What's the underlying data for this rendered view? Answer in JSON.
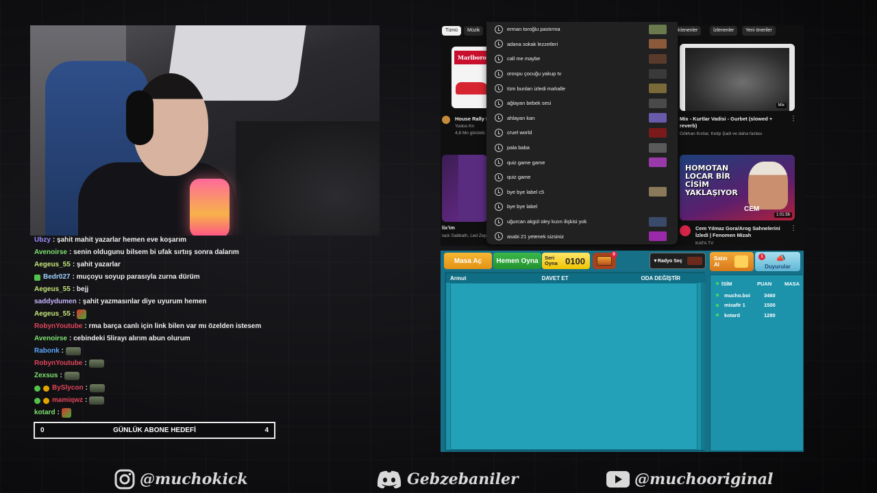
{
  "chat": [
    {
      "user": "Ubzy",
      "color": "#9b8cff",
      "msg": ": şahit mahit yazarlar hemen eve koşarım"
    },
    {
      "user": "Avenoirse",
      "color": "#7ee36e",
      "msg": ": senin oldugunu bilsem bi ufak sırtıış sonra dalarım"
    },
    {
      "user": "Aegeus_55",
      "color": "#c7e87a",
      "msg": ": şahit yazarlar"
    },
    {
      "user": "Bedr027",
      "color": "#9fd0ff",
      "msg": ": muçoyu soyup parasıyla zurna dürüm",
      "prefix": "badge"
    },
    {
      "user": "Aegeus_55",
      "color": "#c7e87a",
      "msg": ": bejj"
    },
    {
      "user": "saddydumen",
      "color": "#c8b6ff",
      "msg": ": şahit yazmasınlar diye uyurum hemen"
    },
    {
      "user": "Aegeus_55",
      "color": "#c7e87a",
      "msg": ":",
      "emote": "small"
    },
    {
      "user": "RobynYoutube",
      "color": "#e2455a",
      "msg": ": rma barça canlı için link bilen var mı özelden istesem"
    },
    {
      "user": "Avenoirse",
      "color": "#7ee36e",
      "msg": ": cebindeki 5lirayı alırım abun olurum"
    },
    {
      "user": "Rabonk",
      "color": "#5aa9ff",
      "msg": ":",
      "emote": "wide"
    },
    {
      "user": "RobynYoutube",
      "color": "#e2455a",
      "msg": ":",
      "emote": "wide"
    },
    {
      "user": "Zexsus",
      "color": "#7ee36e",
      "msg": ":",
      "emote": "wide"
    },
    {
      "user": "BySlycon",
      "color": "#e2455a",
      "msg": ":",
      "emote": "wide",
      "prefix": "badges"
    },
    {
      "user": "mamiqwz",
      "color": "#e2455a",
      "msg": ":",
      "emote": "wide",
      "prefix": "badges"
    },
    {
      "user": "kotard",
      "color": "#7ee36e",
      "msg": ":",
      "emote": "small"
    }
  ],
  "goal": {
    "left": "0",
    "label": "GÜNLÜK ABONE HEDEFİ",
    "right": "4"
  },
  "socials": {
    "instagram": "@muchokick",
    "discord": "Gebzebaniler",
    "youtube": "@muchooriginal"
  },
  "youtube": {
    "chips": [
      "Tümü",
      "Müzik",
      "üklenenler",
      "İzlenenler",
      "Yeni öneriler"
    ],
    "cards": [
      {
        "title": "House Rally P",
        "channel": "Yodoo Kn",
        "meta": "4,8 Mn görüntü"
      },
      {
        "title": "Mix - Kurtlar Vadisi - Gurbet (slowed + reverb)",
        "channel": "Gökhan Kırdar, Ketip Şadi ve daha fazlası",
        "badge": "Mix"
      },
      {
        "title": "lix'im",
        "channel": "lack Sabbath, Led Zep"
      },
      {
        "title": "Cem Yılmaz Gora/Arog Sahnelerini İzledi | Fenomen Mizah",
        "channel": "KAFA TV",
        "duration": "1:01:56",
        "thumb_text": "HOMOTAN LOCAR BİR CİSİM YAKLAŞIYOR",
        "thumb_text2": "CEM"
      }
    ],
    "marlboro": "Marlboro",
    "suggestions": [
      "erman toroğlu pastırma",
      "adana sokak lezzetleri",
      "call me maybe",
      "orospu çocuğu yakup tv",
      "tüm bunları izledi mahalle",
      "ağlayan bebek sesi",
      "ahlayan karı",
      "cruel world",
      "pala baba",
      "quiz game game",
      "quiz game",
      "bye bye label c5",
      "bye bye label",
      "uğurcan akgül oley kızın ilişkisi yok",
      "asabi 21 yetenek sizsiniz"
    ]
  },
  "game": {
    "masa_ac": "Masa Aç",
    "hemen_oyna": "Hemen Oyna",
    "seri_oyna": "Seri Oyna",
    "score": "0100",
    "chest_count": "0",
    "radio": "▼Radyo Seç",
    "satin_al": "Satın Al",
    "duyurular": "Duyurular",
    "duyuru_count": "1",
    "room_name": "Armut",
    "invite": "DAVET ET",
    "change_room": "ODA DEĞİŞTİR",
    "headers": {
      "name": "İSİM",
      "points": "PUAN",
      "table": "MASA"
    },
    "players": [
      {
        "name": "mucho.boi",
        "points": "3460"
      },
      {
        "name": "misafir 1",
        "points": "1500"
      },
      {
        "name": "kotard",
        "points": "1280"
      }
    ]
  }
}
